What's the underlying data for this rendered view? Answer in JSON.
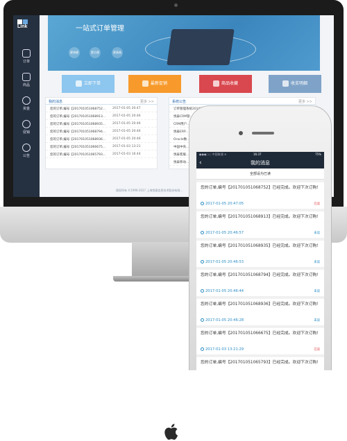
{
  "sidebar": {
    "logo": "Link",
    "items": [
      {
        "label": "订单"
      },
      {
        "label": "商品"
      },
      {
        "label": "资金"
      },
      {
        "label": "促销"
      },
      {
        "label": "公告"
      }
    ]
  },
  "banner": {
    "title": "一站式订单管理",
    "circles": [
      "更快捷",
      "更方便",
      "更高效"
    ]
  },
  "quick_buttons": [
    {
      "label": "立即下单",
      "color": "#8dc6ee"
    },
    {
      "label": "最新促销",
      "color": "#f79a2b"
    },
    {
      "label": "商品收藏",
      "color": "#d9484e"
    },
    {
      "label": "收支明细",
      "color": "#7fa3c8"
    }
  ],
  "messages_panel": {
    "title": "我的消息",
    "more": "更多 >>",
    "rows": [
      {
        "text": "您的订单,编号【20170105106875​2...",
        "date": "2017-01-05 20:47"
      },
      {
        "text": "您的订单,编号【2017010510689​13...",
        "date": "2017-01-05 20:46"
      },
      {
        "text": "您的订单,编号【2017010510689​35...",
        "date": "2017-01-05 20:46"
      },
      {
        "text": "您的订单,编号【2017010510687​94...",
        "date": "2017-01-05 20:46"
      },
      {
        "text": "您的订单,编号【2017010510689​36...",
        "date": "2017-01-05 20:46"
      },
      {
        "text": "您的订单,编号【2017010510666​75...",
        "date": "2017-01-03 13:21"
      },
      {
        "text": "您的订单,编号【2017010510657​93...",
        "date": "2017-01-03 16:44"
      }
    ]
  },
  "notice_panel": {
    "title": "系统公告",
    "more": "更多 >>",
    "rows": [
      {
        "text": "订单管理系统2018年..."
      },
      {
        "text": "悦泰CRM管..."
      },
      {
        "text": "CRM用户..."
      },
      {
        "text": "悦泰ERP..."
      },
      {
        "text": "Oracle数..."
      },
      {
        "text": "中国中央..."
      },
      {
        "text": "悦泰客服..."
      },
      {
        "text": "悦泰移动..."
      }
    ]
  },
  "footer": "版权所有 ©1996-2017 上海悦泰信息技术股份有限...",
  "phone": {
    "status": {
      "carrier": "●●●○○ 中国联通 ≋",
      "time": "16:37",
      "battery": "75%"
    },
    "title": "我的消息",
    "back": "‹",
    "mark_all": "全部设为已读",
    "messages": [
      {
        "text": "您的订单,编号【20170105106875​2】已经完成。欢迎下次订购!",
        "date": "2017-01-05 20:47:05",
        "status": "已读",
        "status_color": "#e0484e"
      },
      {
        "text": "您的订单,编号【20170105106891​3】已经完成。欢迎下次订购!",
        "date": "2017-01-05 20:46:57",
        "status": "未读",
        "status_color": "#2a8cc4"
      },
      {
        "text": "您的订单,编号【20170105106893​5】已经完成。欢迎下次订购!",
        "date": "2017-01-05 20:46:53",
        "status": "未读",
        "status_color": "#2a8cc4"
      },
      {
        "text": "您的订单,编号【20170105106879​4】已经完成。欢迎下次订购!",
        "date": "2017-01-05 20:46:44",
        "status": "未读",
        "status_color": "#2a8cc4"
      },
      {
        "text": "您的订单,编号【20170105106893​6】已经完成。欢迎下次订购!",
        "date": "2017-01-05 20:46:28",
        "status": "未读",
        "status_color": "#2a8cc4"
      },
      {
        "text": "您的订单,编号【20170105106667​5】已经完成。欢迎下次订购!",
        "date": "2017-01-03 13:21:29",
        "status": "已读",
        "status_color": "#e0484e"
      },
      {
        "text": "您的订单,编号【20170105106579​3】已经完成。欢迎下次订购!",
        "date": "",
        "status": "",
        "status_color": "#2a8cc4"
      }
    ]
  }
}
